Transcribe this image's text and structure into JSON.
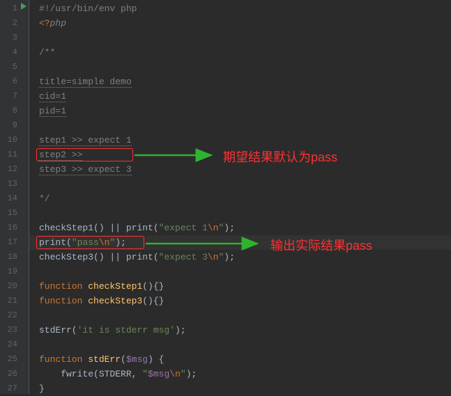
{
  "gutter": {
    "lines": [
      "1",
      "2",
      "3",
      "4",
      "5",
      "6",
      "7",
      "8",
      "9",
      "10",
      "11",
      "12",
      "13",
      "14",
      "15",
      "16",
      "17",
      "18",
      "19",
      "20",
      "21",
      "22",
      "23",
      "24",
      "25",
      "26",
      "27"
    ]
  },
  "code": {
    "l1": "#!/usr/bin/env php",
    "l2a": "<?",
    "l2b": "php",
    "l4": "/**",
    "l6": "title=simple demo",
    "l7": "cid=1",
    "l8": "pid=1",
    "l10": "step1 >> expect 1",
    "l11": "step2 >>",
    "l12": "step3 >> expect 3",
    "l14": "*/",
    "l16a": "checkStep1",
    "l16b": "() || ",
    "l16c": "print",
    "l16d": "(",
    "l16e": "\"expect 1",
    "l16f": "\\n",
    "l16g": "\"",
    "l16h": ");",
    "l17a": "print",
    "l17b": "(",
    "l17c": "\"pass",
    "l17d": "\\n",
    "l17e": "\"",
    "l17f": ");",
    "l18a": "checkStep3",
    "l18b": "() || ",
    "l18c": "print",
    "l18d": "(",
    "l18e": "\"expect 3",
    "l18f": "\\n",
    "l18g": "\"",
    "l18h": ");",
    "l20a": "function ",
    "l20b": "checkStep1",
    "l20c": "(){}",
    "l21a": "function ",
    "l21b": "checkStep3",
    "l21c": "(){}",
    "l23a": "stdErr(",
    "l23b": "'it is stderr msg'",
    "l23c": ");",
    "l25a": "function ",
    "l25b": "stdErr",
    "l25c": "(",
    "l25d": "$msg",
    "l25e": ") {",
    "l26a": "    fwrite",
    "l26b": "(STDERR, ",
    "l26c": "\"",
    "l26d": "$msg",
    "l26e": "\\n",
    "l26f": "\"",
    "l26g": ");",
    "l27": "}"
  },
  "annotations": {
    "a1": "期望结果默认为pass",
    "a2": "输出实际结果pass"
  },
  "colors": {
    "red": "#ff3030",
    "green_arrow": "#2fb32f"
  }
}
